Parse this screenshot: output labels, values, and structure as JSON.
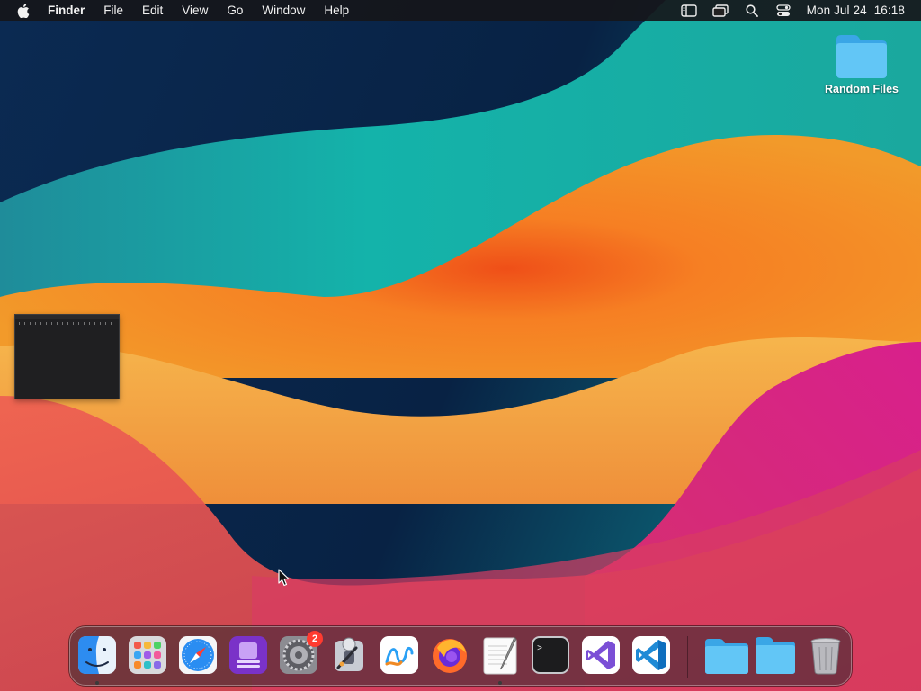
{
  "menubar": {
    "app_name": "Finder",
    "menus": [
      "File",
      "Edit",
      "View",
      "Go",
      "Window",
      "Help"
    ],
    "clock_date": "Mon Jul 24",
    "clock_time": "16:18",
    "status_icons": [
      "sidebar-icon",
      "screen-mirroring-icon",
      "spotlight-search-icon",
      "control-center-icon"
    ]
  },
  "desktop": {
    "icons": [
      {
        "label": "Random Files",
        "icon": "folder-icon"
      }
    ]
  },
  "dock": {
    "apps": [
      {
        "name": "Finder",
        "icon": "finder-icon",
        "running": true
      },
      {
        "name": "Launchpad",
        "icon": "launchpad-icon"
      },
      {
        "name": "Safari",
        "icon": "safari-icon"
      },
      {
        "name": "Simulator",
        "icon": "simulator-icon"
      },
      {
        "name": "System Settings",
        "icon": "system-settings-icon",
        "badge": "2"
      },
      {
        "name": "Automator",
        "icon": "automator-icon"
      },
      {
        "name": "Freeform",
        "icon": "freeform-icon"
      },
      {
        "name": "Firefox",
        "icon": "firefox-icon"
      },
      {
        "name": "TextEdit",
        "icon": "textedit-icon",
        "running": true
      },
      {
        "name": "Terminal",
        "icon": "terminal-icon"
      },
      {
        "name": "Visual Studio",
        "icon": "visual-studio-icon"
      },
      {
        "name": "Visual Studio Code",
        "icon": "vscode-icon"
      }
    ],
    "stacks": [
      {
        "name": "Folder",
        "icon": "folder-icon"
      },
      {
        "name": "Downloads",
        "icon": "folder-icon"
      },
      {
        "name": "Trash",
        "icon": "trash-icon"
      }
    ],
    "terminal_prompt": ">_"
  },
  "colors": {
    "accent_folder": "#5ec4f5",
    "badge": "#ff3b30",
    "menubar": "#16161a"
  }
}
